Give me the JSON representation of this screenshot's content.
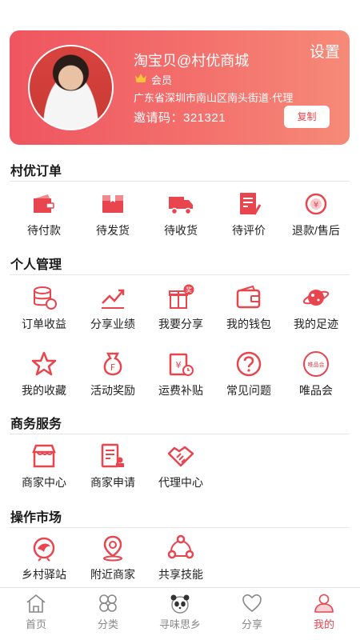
{
  "colors": {
    "accent": "#e8454f",
    "card_start": "#ef5560",
    "card_end": "#f68a78"
  },
  "profile": {
    "username": "淘宝贝@村优商城",
    "settings_label": "设置",
    "member_label": "会员",
    "address": "广东省深圳市南山区南头街道·代理",
    "invite_code": "邀请码：321321",
    "copy_label": "复制"
  },
  "orders": {
    "title": "村优订单",
    "items": [
      {
        "label": "待付款",
        "icon": "wallet-icon"
      },
      {
        "label": "待发货",
        "icon": "box-icon"
      },
      {
        "label": "待收货",
        "icon": "truck-icon"
      },
      {
        "label": "待评价",
        "icon": "edit-note-icon"
      },
      {
        "label": "退款/售后",
        "icon": "refund-icon"
      }
    ]
  },
  "personal": {
    "title": "个人管理",
    "items": [
      {
        "label": "订单收益",
        "icon": "coins-icon"
      },
      {
        "label": "分享业绩",
        "icon": "trend-icon"
      },
      {
        "label": "我要分享",
        "icon": "gift-icon",
        "badge": "奖"
      },
      {
        "label": "我的钱包",
        "icon": "wallet-icon"
      },
      {
        "label": "我的足迹",
        "icon": "planet-icon"
      },
      {
        "label": "我的收藏",
        "icon": "star-icon"
      },
      {
        "label": "活动奖励",
        "icon": "money-bag-icon"
      },
      {
        "label": "运费补贴",
        "icon": "subsidy-icon"
      },
      {
        "label": "常见问题",
        "icon": "question-icon"
      },
      {
        "label": "唯品会",
        "icon": "vip-icon",
        "badge": "唯品会"
      }
    ]
  },
  "business": {
    "title": "商务服务",
    "items": [
      {
        "label": "商家中心",
        "icon": "shop-icon"
      },
      {
        "label": "商家申请",
        "icon": "apply-icon"
      },
      {
        "label": "代理中心",
        "icon": "handshake-icon"
      }
    ]
  },
  "market": {
    "title": "操作市场",
    "items": [
      {
        "label": "乡村驿站",
        "icon": "bird-icon"
      },
      {
        "label": "附近商家",
        "icon": "location-icon"
      },
      {
        "label": "共享技能",
        "icon": "share-network-icon"
      }
    ]
  },
  "tabbar": {
    "items": [
      {
        "label": "首页",
        "icon": "home-icon"
      },
      {
        "label": "分类",
        "icon": "clover-icon"
      },
      {
        "label": "寻味思乡",
        "icon": "panda-icon"
      },
      {
        "label": "分享",
        "icon": "heart-icon"
      },
      {
        "label": "我的",
        "icon": "user-icon",
        "active": true
      }
    ]
  }
}
